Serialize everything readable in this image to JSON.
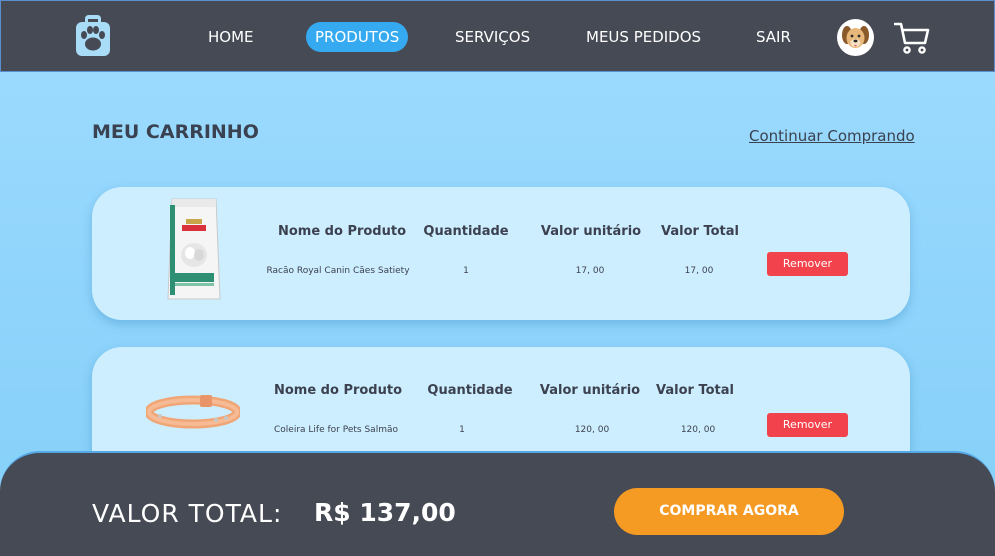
{
  "nav": {
    "logo_icon": "paw-bag-icon",
    "links": [
      {
        "label": "HOME"
      },
      {
        "label": "PRODUTOS",
        "active": true
      },
      {
        "label": "SERVIÇOS"
      },
      {
        "label": "MEUS PEDIDOS"
      },
      {
        "label": "SAIR"
      }
    ],
    "avatar_icon": "dog-avatar-icon",
    "cart_icon": "shopping-cart-icon"
  },
  "cart": {
    "title": "MEU CARRINHO",
    "continue_link": "Continuar Comprando",
    "columns": {
      "name": "Nome do Produto",
      "quantity": "Quantidade",
      "unit_price": "Valor unitário",
      "total": "Valor Total"
    },
    "items": [
      {
        "image_icon": "dog-food-bag-icon",
        "name": "Racão Royal Canin Cães Satiety",
        "quantity": "1",
        "unit_price": "17, 00",
        "total": "17, 00",
        "remove_label": "Remover"
      },
      {
        "image_icon": "dog-collar-icon",
        "name": "Coleira Life for Pets Salmão",
        "quantity": "1",
        "unit_price": "120, 00",
        "total": "120, 00",
        "remove_label": "Remover"
      }
    ]
  },
  "footer": {
    "total_label": "VALOR TOTAL:",
    "total_value": "R$ 137,00",
    "buy_label": "COMPRAR AGORA"
  },
  "colors": {
    "navbar_bg": "#464a54",
    "active_tab": "#36aaf0",
    "page_bg": "#9fdcff",
    "card_bg": "#cdeeff",
    "remove_button": "#f2434c",
    "buy_button": "#f59a23"
  }
}
